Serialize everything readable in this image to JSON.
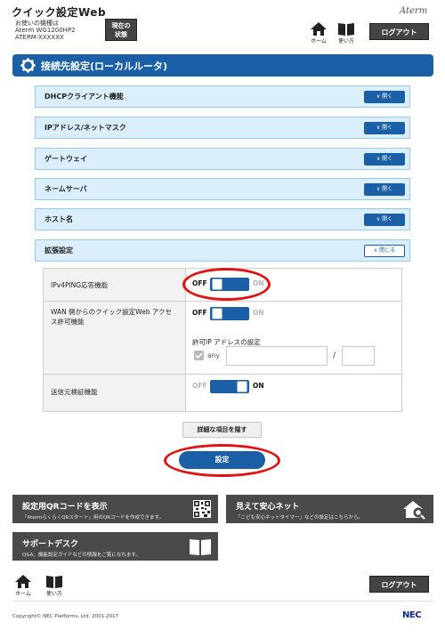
{
  "header": {
    "app_title": "クイック設定Web",
    "model_caption": "お使いの機種は",
    "model_name": "Aterm WG1200HP2",
    "model_id": "ATERM-XXXXXX",
    "status_button": [
      "現在の",
      "状態"
    ],
    "brand": "Aterm",
    "home_label": "ホーム",
    "howto_label": "使い方",
    "logout_label": "ログアウト"
  },
  "page": {
    "title": "接続先設定(ローカルルータ)"
  },
  "sections": [
    {
      "label": "DHCPクライアント機能",
      "button": "開く"
    },
    {
      "label": "IPアドレス/ネットマスク",
      "button": "開く"
    },
    {
      "label": "ゲートウェイ",
      "button": "開く"
    },
    {
      "label": "ネームサーバ",
      "button": "開く"
    },
    {
      "label": "ホスト名",
      "button": "開く"
    },
    {
      "label": "拡張設定",
      "button": "閉じる"
    }
  ],
  "settings": {
    "ping": {
      "label": "IPv4PING応答機能",
      "off": "OFF",
      "on": "ON",
      "state": "off"
    },
    "wan": {
      "label": "WAN 側からのクイック設定Web アクセス許可機能",
      "off": "OFF",
      "on": "ON",
      "state": "off",
      "ip_label": "許可IP アドレスの設定",
      "any_label": "any",
      "ip_value": "",
      "mask_value": "",
      "separator": "/"
    },
    "source": {
      "label": "送信元検証機能",
      "off": "OFF",
      "on": "ON",
      "state": "on"
    }
  },
  "actions": {
    "hide_details": "詳細な項目を隠す",
    "apply": "設定"
  },
  "tiles": {
    "qr": {
      "title": "設定用QRコードを表示",
      "desc": "「AtermらくらくQRスタート」用のQRコードを作成できます。"
    },
    "safe": {
      "title": "見えて安心ネット",
      "desc": "「こども安心ネットタイマー」などの設定はこちらから。"
    },
    "support": {
      "title": "サポートデスク",
      "desc": "Q&A、機能設定ガイドなどの情報をご覧になれます。"
    }
  },
  "footer": {
    "home_label": "ホーム",
    "howto_label": "使い方",
    "logout_label": "ログアウト",
    "copyright": "Copyright© NEC Platforms, Ltd. 2001-2017",
    "nec": "NEC"
  },
  "colors": {
    "accent": "#1b5fa6",
    "section_bg": "#daeefb",
    "highlight": "#e01212",
    "tile_bg": "#4a4a4a"
  }
}
